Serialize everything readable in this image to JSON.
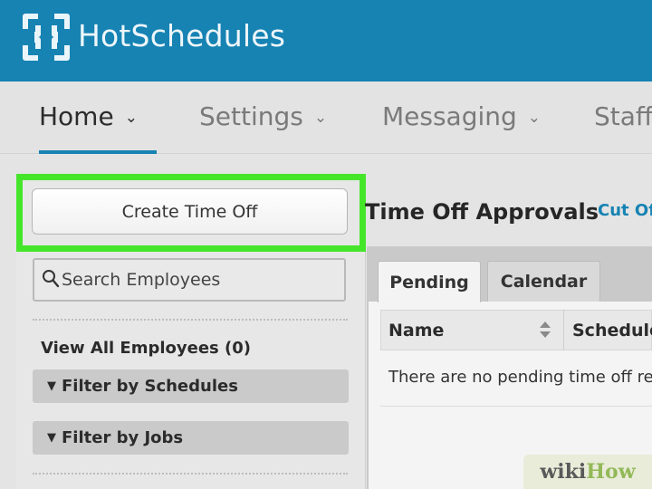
{
  "header": {
    "app_title": "HotSchedules",
    "logo_icon": "hotschedules-logo-icon",
    "bg_color": "#1683b3"
  },
  "nav": {
    "items": [
      {
        "label": "Home",
        "active": true,
        "icon": "chevron-down-icon"
      },
      {
        "label": "Settings",
        "active": false,
        "icon": "chevron-down-icon"
      },
      {
        "label": "Messaging",
        "active": false,
        "icon": "chevron-down-icon"
      },
      {
        "label": "Staff",
        "active": false
      }
    ],
    "chevron": "⌄"
  },
  "left_panel": {
    "create_button_label": "Create Time Off",
    "search_placeholder": "Search Employees",
    "search_icon": "search-icon",
    "view_all_label": "View All Employees (0)",
    "filters": [
      {
        "label": "Filter by Schedules",
        "icon": "triangle-down-icon"
      },
      {
        "label": "Filter by Jobs",
        "icon": "triangle-down-icon"
      }
    ],
    "highlight_color": "#45e62a"
  },
  "main": {
    "title": "Time Off Approvals",
    "cutoff_link": "Cut Off",
    "tabs": [
      {
        "label": "Pending",
        "active": true
      },
      {
        "label": "Calendar",
        "active": false
      }
    ],
    "table": {
      "columns": [
        "Name",
        "Schedule"
      ],
      "empty_message": "There are no pending time off requests",
      "sort_icon": "sort-icon"
    }
  },
  "watermark": {
    "part1": "wiki",
    "part2": "How"
  }
}
